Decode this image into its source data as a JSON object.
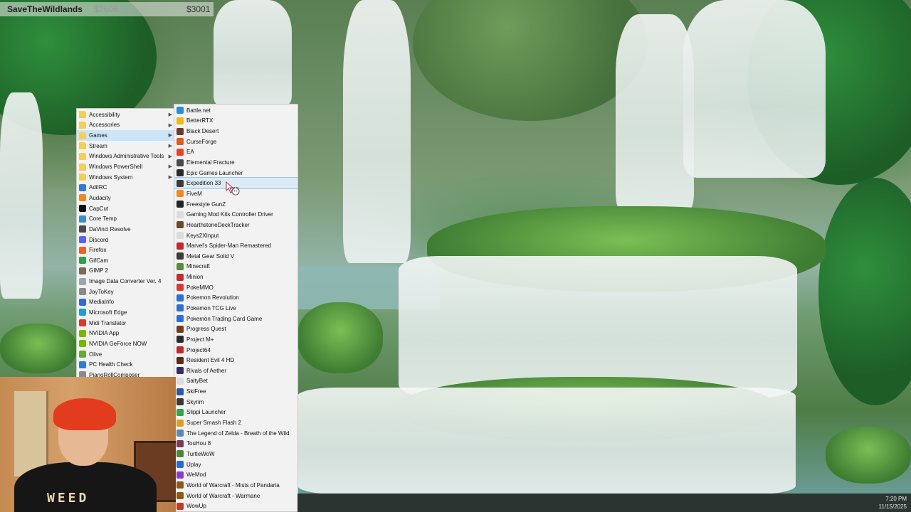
{
  "overlay": {
    "stream_title": "SaveTheWildlands",
    "amount_faded": "$2606",
    "amount": "$3001"
  },
  "programs_menu": {
    "items": [
      {
        "label": "Accessibility",
        "icon": "folder-icon",
        "color": "#f2cf5b",
        "submenu": true
      },
      {
        "label": "Accessories",
        "icon": "folder-icon",
        "color": "#f2cf5b",
        "submenu": true
      },
      {
        "label": "Games",
        "icon": "folder-icon",
        "color": "#f2cf5b",
        "submenu": true,
        "selected": true
      },
      {
        "label": "Stream",
        "icon": "folder-icon",
        "color": "#f2cf5b",
        "submenu": true
      },
      {
        "label": "Windows Administrative Tools",
        "icon": "folder-icon",
        "color": "#f2cf5b",
        "submenu": true
      },
      {
        "label": "Windows PowerShell",
        "icon": "folder-icon",
        "color": "#f2cf5b",
        "submenu": true
      },
      {
        "label": "Windows System",
        "icon": "folder-icon",
        "color": "#f2cf5b",
        "submenu": true
      },
      {
        "label": "AdiIRC",
        "icon": "adiirc-icon",
        "color": "#2f7bd6"
      },
      {
        "label": "Audacity",
        "icon": "audacity-icon",
        "color": "#f08a1c"
      },
      {
        "label": "CapCut",
        "icon": "capcut-icon",
        "color": "#111111"
      },
      {
        "label": "Core Temp",
        "icon": "coretemp-icon",
        "color": "#3a8fd0"
      },
      {
        "label": "DaVinci Resolve",
        "icon": "davinci-icon",
        "color": "#4a4a4a"
      },
      {
        "label": "Discord",
        "icon": "discord-icon",
        "color": "#5865f2"
      },
      {
        "label": "Firefox",
        "icon": "firefox-icon",
        "color": "#e8642a"
      },
      {
        "label": "GifCam",
        "icon": "gifcam-icon",
        "color": "#2aa24a"
      },
      {
        "label": "GIMP 2",
        "icon": "gimp-icon",
        "color": "#7a6a55"
      },
      {
        "label": "Image Data Converter Ver. 4",
        "icon": "image-converter-icon",
        "color": "#9aa6b2"
      },
      {
        "label": "JoyToKey",
        "icon": "joytokey-icon",
        "color": "#8a8a8a"
      },
      {
        "label": "MediaInfo",
        "icon": "mediainfo-icon",
        "color": "#2e6bd8"
      },
      {
        "label": "Microsoft Edge",
        "icon": "edge-icon",
        "color": "#1f9cd8"
      },
      {
        "label": "Midi Translator",
        "icon": "midi-icon",
        "color": "#d83a2e"
      },
      {
        "label": "NVIDIA App",
        "icon": "nvidia-icon",
        "color": "#76b900"
      },
      {
        "label": "NVIDIA GeForce NOW",
        "icon": "geforce-now-icon",
        "color": "#76b900"
      },
      {
        "label": "Olive",
        "icon": "olive-icon",
        "color": "#6aa83a"
      },
      {
        "label": "PC Health Check",
        "icon": "pc-health-icon",
        "color": "#2f7bd6"
      },
      {
        "label": "PianoRollComposer",
        "icon": "piano-icon",
        "color": "#8a8a8a"
      }
    ]
  },
  "games_menu": {
    "items": [
      {
        "label": "Battle.net",
        "icon": "battlenet-icon",
        "color": "#2a8cd6"
      },
      {
        "label": "BetterRTX",
        "icon": "betterrtx-icon",
        "color": "#f0b81c"
      },
      {
        "label": "Black Desert",
        "icon": "black-desert-icon",
        "color": "#6b3a2a"
      },
      {
        "label": "CurseForge",
        "icon": "curseforge-icon",
        "color": "#e25a1c"
      },
      {
        "label": "EA",
        "icon": "ea-icon",
        "color": "#e8412a"
      },
      {
        "label": "Elemental Fracture",
        "icon": "game-icon",
        "color": "#4a4a4a"
      },
      {
        "label": "Epic Games Launcher",
        "icon": "epic-icon",
        "color": "#2a2a2a"
      },
      {
        "label": "Expedition 33",
        "icon": "game-icon",
        "color": "#3a3a3a",
        "selected": true
      },
      {
        "label": "FiveM",
        "icon": "fivem-icon",
        "color": "#f08a1c"
      },
      {
        "label": "Freestyle GunZ",
        "icon": "gunz-icon",
        "color": "#222222"
      },
      {
        "label": "Gaming Mod Kits Controller Driver",
        "icon": "app-icon",
        "color": "#dcdcdc"
      },
      {
        "label": "HearthstoneDeckTracker",
        "icon": "hdt-icon",
        "color": "#6a4a2a"
      },
      {
        "label": "Keys2XInput",
        "icon": "app-icon",
        "color": "#dcdcdc"
      },
      {
        "label": "Marvel's Spider-Man Remastered",
        "icon": "spiderman-icon",
        "color": "#c0282a"
      },
      {
        "label": "Metal Gear Solid V",
        "icon": "mgs-icon",
        "color": "#3a3a3a"
      },
      {
        "label": "Minecraft",
        "icon": "minecraft-icon",
        "color": "#5a8a3a"
      },
      {
        "label": "Minion",
        "icon": "minion-icon",
        "color": "#c82a2a"
      },
      {
        "label": "PokeMMO",
        "icon": "pokemmo-icon",
        "color": "#d83a3a"
      },
      {
        "label": "Pokemon Revolution",
        "icon": "pokemon-icon",
        "color": "#2f6fd0"
      },
      {
        "label": "Pokemon TCG Live",
        "icon": "pokemon-icon",
        "color": "#2f6fd0"
      },
      {
        "label": "Pokemon Trading Card Game",
        "icon": "pokemon-icon",
        "color": "#2f6fd0"
      },
      {
        "label": "Progress Quest",
        "icon": "progress-quest-icon",
        "color": "#7a3a1a"
      },
      {
        "label": "Project M+",
        "icon": "project-m-icon",
        "color": "#2a2a2a"
      },
      {
        "label": "Project64",
        "icon": "project64-icon",
        "color": "#c02a2a"
      },
      {
        "label": "Resident Evil 4 HD",
        "icon": "re4-icon",
        "color": "#5a2a1a"
      },
      {
        "label": "Rivals of Aether",
        "icon": "rivals-icon",
        "color": "#3a2a6a"
      },
      {
        "label": "SaltyBet",
        "icon": "app-icon",
        "color": "#dcdcdc"
      },
      {
        "label": "SkiFree",
        "icon": "skifree-icon",
        "color": "#2a5a9a"
      },
      {
        "label": "Skyrim",
        "icon": "skyrim-icon",
        "color": "#3a3a3a"
      },
      {
        "label": "Slippi Launcher",
        "icon": "slippi-icon",
        "color": "#2aa84a"
      },
      {
        "label": "Super Smash Flash 2",
        "icon": "ssf2-icon",
        "color": "#d8a02a"
      },
      {
        "label": "The Legend of Zelda - Breath of the Wild",
        "icon": "zelda-icon",
        "color": "#5a8ab0"
      },
      {
        "label": "TouHou 8",
        "icon": "touhou-icon",
        "color": "#7a3a5a"
      },
      {
        "label": "TurtleWoW",
        "icon": "turtlewow-icon",
        "color": "#4a8a3a"
      },
      {
        "label": "Uplay",
        "icon": "uplay-icon",
        "color": "#2a6ad0"
      },
      {
        "label": "WeMod",
        "icon": "wemod-icon",
        "color": "#8a3ad0"
      },
      {
        "label": "World of Warcraft - Mists of Pandaria",
        "icon": "wow-icon",
        "color": "#8a5a1a"
      },
      {
        "label": "World of Warcraft - Warmane",
        "icon": "wow-icon",
        "color": "#8a5a1a"
      },
      {
        "label": "WowUp",
        "icon": "wowup-icon",
        "color": "#c03a2a"
      }
    ]
  },
  "webcam": {
    "shirt_text": "WEED"
  },
  "taskbar": {
    "time": "7:20 PM",
    "date": "11/15/2025"
  }
}
